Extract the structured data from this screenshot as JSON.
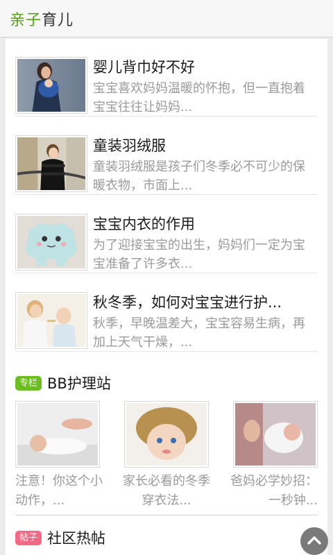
{
  "header": {
    "title_accent": "亲子",
    "title_rest": "育儿"
  },
  "articles": [
    {
      "title": "婴儿背巾好不好",
      "desc": "宝宝喜欢妈妈温暖的怀抱，但一直抱着宝宝往往让妈妈..."
    },
    {
      "title": "童装羽绒服",
      "desc": "童装羽绒服是孩子们冬季必不可少的保暖衣物，市面上..."
    },
    {
      "title": "宝宝内衣的作用",
      "desc": "为了迎接宝宝的出生，妈妈们一定为宝宝准备了许多衣..."
    },
    {
      "title": "秋冬季，如何对宝宝进行护...",
      "desc": "秋季，早晚温差大，宝宝容易生病，再加上天气干燥，..."
    }
  ],
  "section_bb": {
    "tag": "专栏",
    "title": "BB护理站",
    "items": [
      {
        "caption": "注意！你这个小动作，..."
      },
      {
        "caption": "家长必看的冬季穿衣法..."
      },
      {
        "caption": "爸妈必学妙招：一秒钟..."
      }
    ]
  },
  "section_forum": {
    "tag": "帖子",
    "title": "社区热帖"
  },
  "colors": {
    "accent": "#57a31c",
    "tag_green": "#6bbd22",
    "tag_pink": "#f06a86"
  },
  "icons": {
    "scroll_top": "chevron-up-icon"
  }
}
